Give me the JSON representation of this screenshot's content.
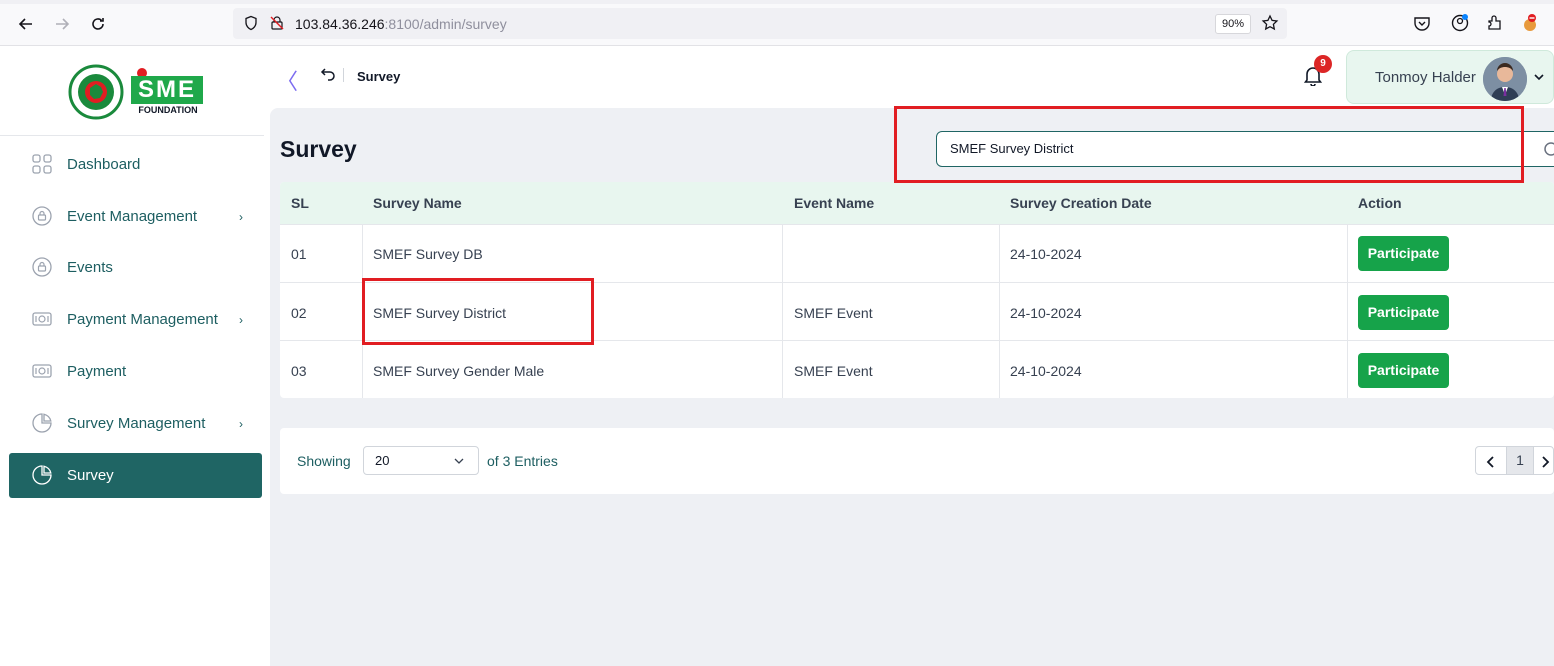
{
  "browser": {
    "url_host": "103.84.36.246",
    "url_rest": ":8100/admin/survey",
    "zoom": "90%"
  },
  "sidebar": {
    "logo_text": "SME",
    "logo_sub": "FOUNDATION",
    "items": [
      {
        "label": "Dashboard",
        "icon": "grid-icon",
        "has_chevron": false
      },
      {
        "label": "Event Management",
        "icon": "lock-circle-icon",
        "has_chevron": true
      },
      {
        "label": "Events",
        "icon": "lock-circle-icon",
        "has_chevron": false
      },
      {
        "label": "Payment Management",
        "icon": "money-icon",
        "has_chevron": true
      },
      {
        "label": "Payment",
        "icon": "money-icon",
        "has_chevron": false
      },
      {
        "label": "Survey Management",
        "icon": "pie-chart-icon",
        "has_chevron": true
      },
      {
        "label": "Survey",
        "icon": "pie-chart-icon",
        "has_chevron": false,
        "active": true
      }
    ],
    "chevron": "›"
  },
  "header": {
    "back_glyph": "〈",
    "breadcrumb": "Survey",
    "notification_count": "9",
    "user_name": "Tonmoy Halder"
  },
  "page": {
    "title": "Survey",
    "search_value": "SMEF Survey District"
  },
  "table": {
    "columns": [
      "SL",
      "Survey Name",
      "Event Name",
      "Survey Creation Date",
      "Action"
    ],
    "rows": [
      {
        "sl": "01",
        "survey_name": "SMEF Survey DB",
        "event_name": "",
        "date": "24-10-2024",
        "action": "Participate"
      },
      {
        "sl": "02",
        "survey_name": "SMEF Survey District",
        "event_name": "SMEF Event",
        "date": "24-10-2024",
        "action": "Participate"
      },
      {
        "sl": "03",
        "survey_name": "SMEF Survey Gender Male",
        "event_name": "SMEF Event",
        "date": "24-10-2024",
        "action": "Participate"
      }
    ]
  },
  "footer": {
    "showing": "Showing",
    "page_size": "20",
    "entries": "of 3 Entries",
    "current_page": "1"
  },
  "colors": {
    "accent": "#1f6564",
    "header_bg": "#e8f6ef",
    "button_green": "#16a34a",
    "annotation_red": "#e11d22"
  }
}
